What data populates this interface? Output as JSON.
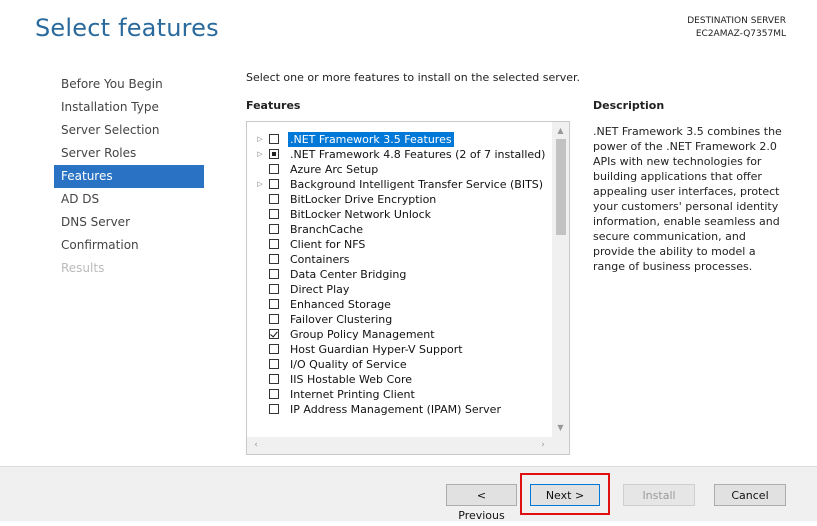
{
  "header": {
    "title": "Select features",
    "destination_label": "DESTINATION SERVER",
    "destination_server": "EC2AMAZ-Q7357ML"
  },
  "nav": {
    "items": [
      {
        "label": "Before You Begin",
        "state": "normal"
      },
      {
        "label": "Installation Type",
        "state": "normal"
      },
      {
        "label": "Server Selection",
        "state": "normal"
      },
      {
        "label": "Server Roles",
        "state": "normal"
      },
      {
        "label": "Features",
        "state": "active"
      },
      {
        "label": "AD DS",
        "state": "normal"
      },
      {
        "label": "DNS Server",
        "state": "normal"
      },
      {
        "label": "Confirmation",
        "state": "normal"
      },
      {
        "label": "Results",
        "state": "disabled"
      }
    ]
  },
  "main": {
    "instruction": "Select one or more features to install on the selected server.",
    "features_heading": "Features",
    "features": [
      {
        "label": ".NET Framework 3.5 Features",
        "expandable": true,
        "check": "unchecked",
        "selected": true
      },
      {
        "label": ".NET Framework 4.8 Features (2 of 7 installed)",
        "expandable": true,
        "check": "partial",
        "selected": false
      },
      {
        "label": "Azure Arc Setup",
        "expandable": false,
        "check": "unchecked",
        "selected": false
      },
      {
        "label": "Background Intelligent Transfer Service (BITS)",
        "expandable": true,
        "check": "unchecked",
        "selected": false
      },
      {
        "label": "BitLocker Drive Encryption",
        "expandable": false,
        "check": "unchecked",
        "selected": false
      },
      {
        "label": "BitLocker Network Unlock",
        "expandable": false,
        "check": "unchecked",
        "selected": false
      },
      {
        "label": "BranchCache",
        "expandable": false,
        "check": "unchecked",
        "selected": false
      },
      {
        "label": "Client for NFS",
        "expandable": false,
        "check": "unchecked",
        "selected": false
      },
      {
        "label": "Containers",
        "expandable": false,
        "check": "unchecked",
        "selected": false
      },
      {
        "label": "Data Center Bridging",
        "expandable": false,
        "check": "unchecked",
        "selected": false
      },
      {
        "label": "Direct Play",
        "expandable": false,
        "check": "unchecked",
        "selected": false
      },
      {
        "label": "Enhanced Storage",
        "expandable": false,
        "check": "unchecked",
        "selected": false
      },
      {
        "label": "Failover Clustering",
        "expandable": false,
        "check": "unchecked",
        "selected": false
      },
      {
        "label": "Group Policy Management",
        "expandable": false,
        "check": "checked",
        "selected": false
      },
      {
        "label": "Host Guardian Hyper-V Support",
        "expandable": false,
        "check": "unchecked",
        "selected": false
      },
      {
        "label": "I/O Quality of Service",
        "expandable": false,
        "check": "unchecked",
        "selected": false
      },
      {
        "label": "IIS Hostable Web Core",
        "expandable": false,
        "check": "unchecked",
        "selected": false
      },
      {
        "label": "Internet Printing Client",
        "expandable": false,
        "check": "unchecked",
        "selected": false
      },
      {
        "label": "IP Address Management (IPAM) Server",
        "expandable": false,
        "check": "unchecked",
        "selected": false
      }
    ],
    "description_heading": "Description",
    "description_text": ".NET Framework 3.5 combines the power of the .NET Framework 2.0 APIs with new technologies for building applications that offer appealing user interfaces, protect your customers' personal identity information, enable seamless and secure communication, and provide the ability to model a range of business processes."
  },
  "footer": {
    "previous_label": "< Previous",
    "next_label": "Next >",
    "install_label": "Install",
    "cancel_label": "Cancel",
    "highlight_color": "#e01010"
  },
  "colors": {
    "title": "#2b6a9c",
    "nav_active_bg": "#2a73c4",
    "selection_bg": "#0078d7"
  }
}
